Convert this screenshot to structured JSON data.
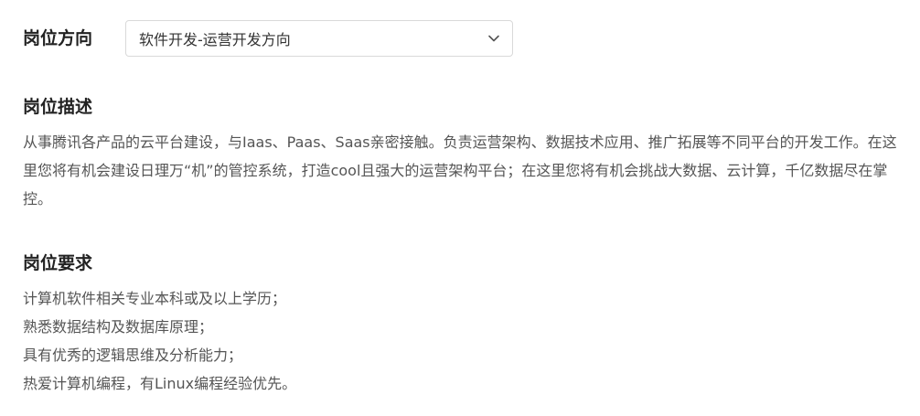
{
  "position_direction": {
    "label": "岗位方向",
    "selected_value": "软件开发-运营开发方向",
    "dropdown_icon": "chevron-down-icon"
  },
  "description": {
    "title": "岗位描述",
    "text": "从事腾讯各产品的云平台建设，与Iaas、Paas、Saas亲密接触。负责运营架构、数据技术应用、推广拓展等不同平台的开发工作。在这里您将有机会建设日理万“机”的管控系统，打造cool且强大的运营架构平台；在这里您将有机会挑战大数据、云计算，千亿数据尽在掌控。"
  },
  "requirements": {
    "title": "岗位要求",
    "items": [
      "计算机软件相关专业本科或及以上学历；",
      "熟悉数据结构及数据库原理；",
      "具有优秀的逻辑思维及分析能力；",
      "热爱计算机编程，有Linux编程经验优先。"
    ]
  },
  "colors": {
    "heading": "#222222",
    "body_text": "#555555",
    "border": "#d9d9d9"
  }
}
